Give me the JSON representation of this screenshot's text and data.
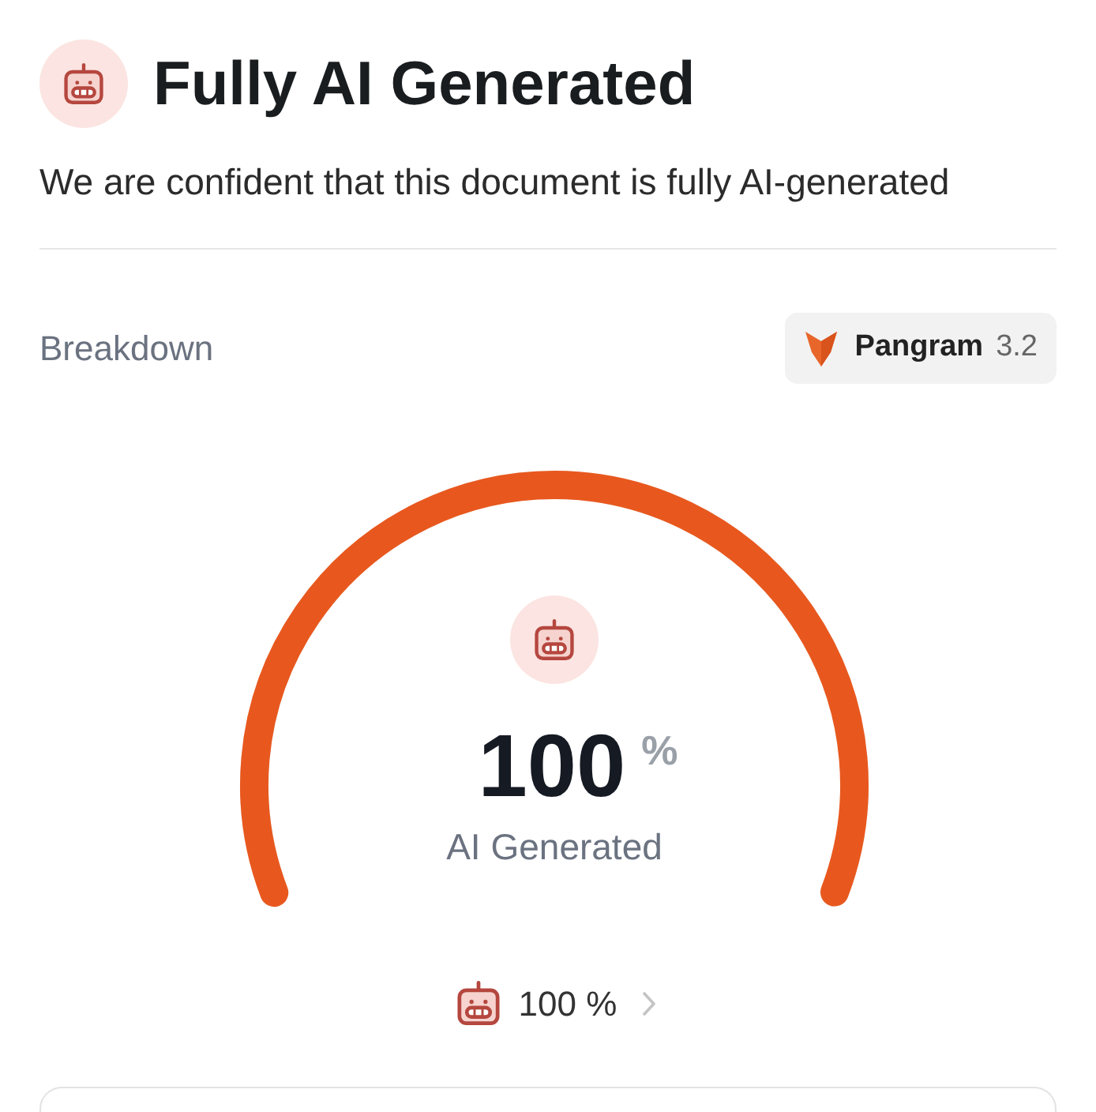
{
  "header": {
    "title": "Fully AI Generated",
    "subtitle": "We are confident that this document is fully AI-generated"
  },
  "breakdown": {
    "label": "Breakdown",
    "model_badge": {
      "name": "Pangram",
      "version": "3.2"
    }
  },
  "gauge": {
    "level": 1,
    "value": "100",
    "unit": "%",
    "label": "AI Generated"
  },
  "segments": [
    {
      "value": "100 %"
    }
  ]
}
